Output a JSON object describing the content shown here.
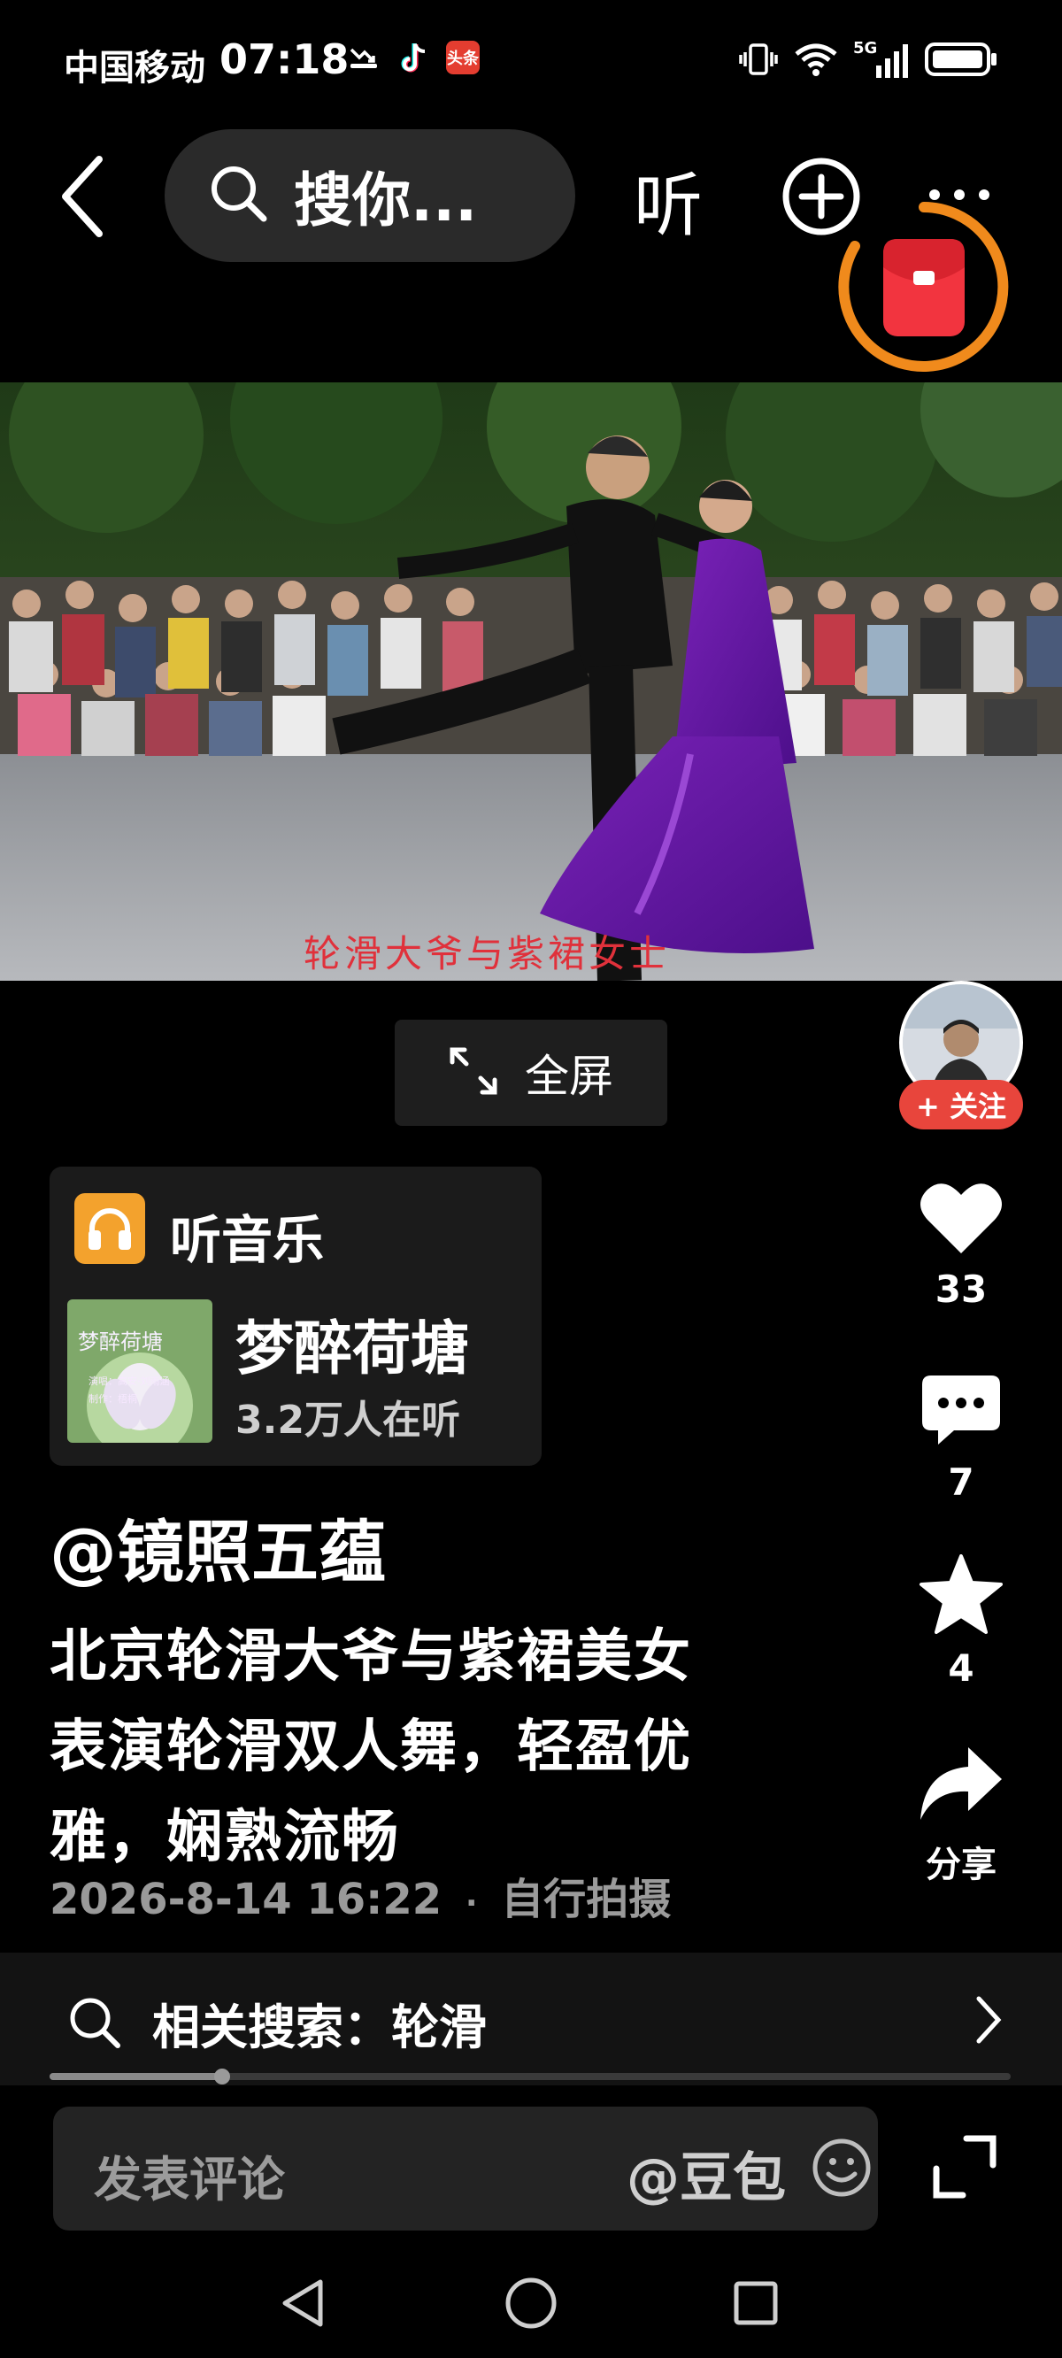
{
  "status_bar": {
    "carrier": "中国移动",
    "time": "07:18",
    "toutiao_badge": "头条",
    "network": "5G",
    "icons_left": [
      "missed-call-icon",
      "tiktok-icon",
      "toutiao-icon"
    ],
    "icons_right": [
      "vibrate-icon",
      "wifi-icon",
      "signal-icon",
      "battery-icon"
    ]
  },
  "top_nav": {
    "search_text": "搜你...",
    "listen_label": "听"
  },
  "video": {
    "caption": "轮滑大爷与紫裙女士",
    "fullscreen_label": "全屏"
  },
  "music_card": {
    "header": "听音乐",
    "title": "梦醉荷塘",
    "listeners": "3.2万人在听",
    "cover_text": "梦醉荷塘",
    "cover_sub1": "演唱：高安·刘雨涵",
    "cover_sub2": "制作：梧桐"
  },
  "post": {
    "author": "@镜照五蕴",
    "description_lines": [
      "北京轮滑大爷与紫裙美女",
      "表演轮滑双人舞，轻盈优",
      "雅，娴熟流畅"
    ],
    "timestamp": "2026-8-14 16:22",
    "separator": "·",
    "source": "自行拍摄"
  },
  "right_rail": {
    "follow_label": "+ 关注",
    "likes": "33",
    "comments": "7",
    "favorites": "4",
    "share_label": "分享"
  },
  "related_search": {
    "text": "相关搜索：轮滑"
  },
  "progress": {
    "fraction": 0.18
  },
  "comment_bar": {
    "placeholder": "发表评论",
    "at_doubao": "@豆包"
  },
  "colors": {
    "accent_red": "#e8453c",
    "redpack_ring": "#f08a1c",
    "music_icon": "#f3a22d"
  }
}
